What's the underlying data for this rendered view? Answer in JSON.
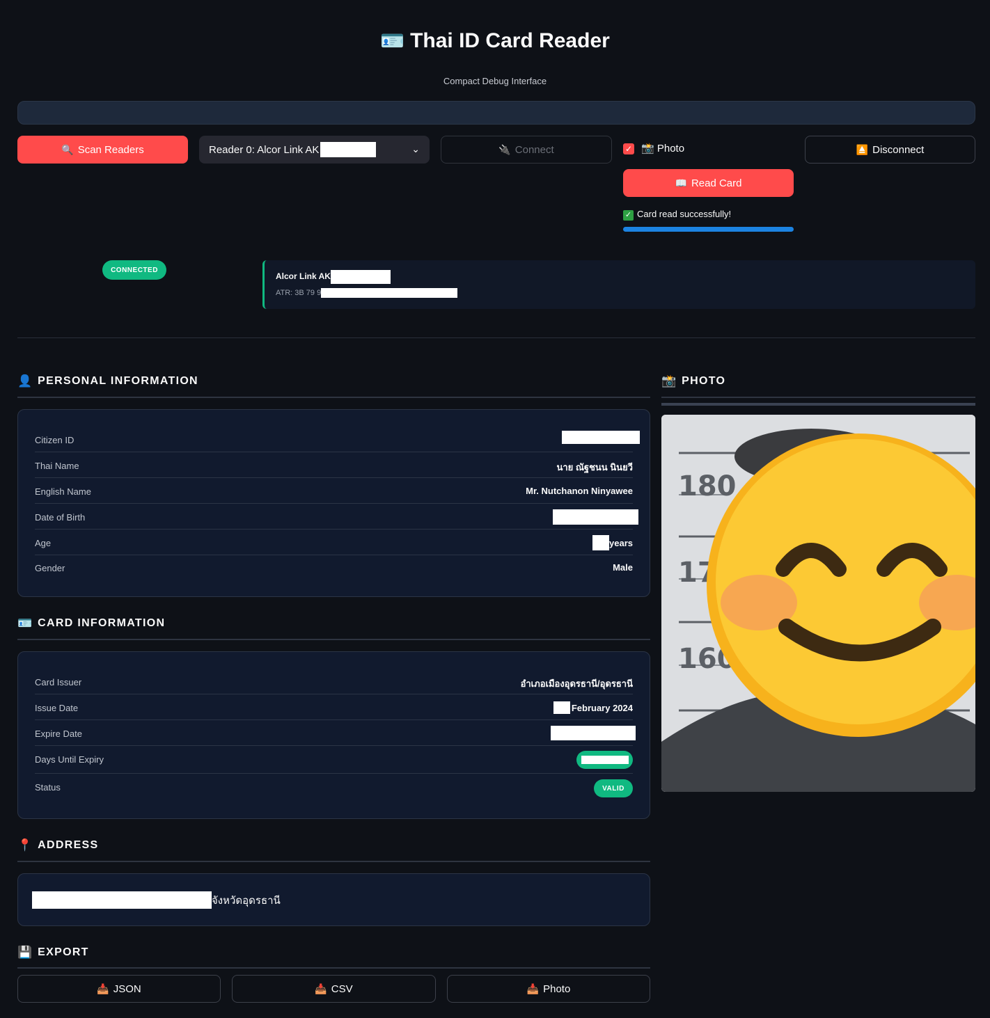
{
  "header": {
    "title": "Thai ID Card Reader",
    "title_icon": "id-card-icon",
    "subtitle": "Compact Debug Interface"
  },
  "toolbar": {
    "scan_label": "Scan Readers",
    "scan_icon": "magnifier-icon",
    "reader_select_value": "Reader 0: Alcor Link AK",
    "connect_label": "Connect",
    "connect_icon": "plug-icon",
    "photo_checkbox_label": "Photo",
    "photo_checkbox_checked": true,
    "disconnect_label": "Disconnect",
    "disconnect_icon": "eject-icon",
    "read_card_label": "Read Card",
    "read_card_icon": "book-icon",
    "success_message": "Card read successfully!",
    "read_progress_percent": 100
  },
  "connection": {
    "status_badge": "CONNECTED",
    "reader_name": "Alcor Link AK",
    "atr_prefix": "ATR: 3B 79 9"
  },
  "personal": {
    "heading": "PERSONAL INFORMATION",
    "icon": "person-icon",
    "rows": {
      "citizen_id_label": "Citizen ID",
      "thai_name_label": "Thai Name",
      "thai_name_value": "นาย ณัฐชนน นินยวี",
      "english_name_label": "English Name",
      "english_name_value": "Mr. Nutchanon Ninyawee",
      "dob_label": "Date of Birth",
      "age_label": "Age",
      "age_suffix": "years",
      "gender_label": "Gender",
      "gender_value": "Male"
    }
  },
  "card": {
    "heading": "CARD INFORMATION",
    "icon": "id-card-icon",
    "rows": {
      "issuer_label": "Card Issuer",
      "issuer_value": "อำเภอเมืองอุดรธานี/อุดรธานี",
      "issue_date_label": "Issue Date",
      "issue_date_suffix": "February 2024",
      "expire_date_label": "Expire Date",
      "days_until_expiry_label": "Days Until Expiry",
      "status_label": "Status",
      "status_value": "VALID"
    }
  },
  "photo": {
    "heading": "PHOTO",
    "icon": "camera-icon",
    "height_marks": [
      "180",
      "170",
      "160"
    ]
  },
  "address": {
    "heading": "ADDRESS",
    "icon": "pin-icon",
    "suffix": "จังหวัดอุดรธานี"
  },
  "export": {
    "heading": "EXPORT",
    "icon": "floppy-icon",
    "json_label": "JSON",
    "csv_label": "CSV",
    "photo_label": "Photo",
    "button_icon": "inbox-download-icon"
  },
  "colors": {
    "background": "#0e1117",
    "accent_red": "#ff4b4b",
    "success_green": "#10b981",
    "progress_blue": "#1c83e1",
    "panel_bg": "#111a2e"
  }
}
